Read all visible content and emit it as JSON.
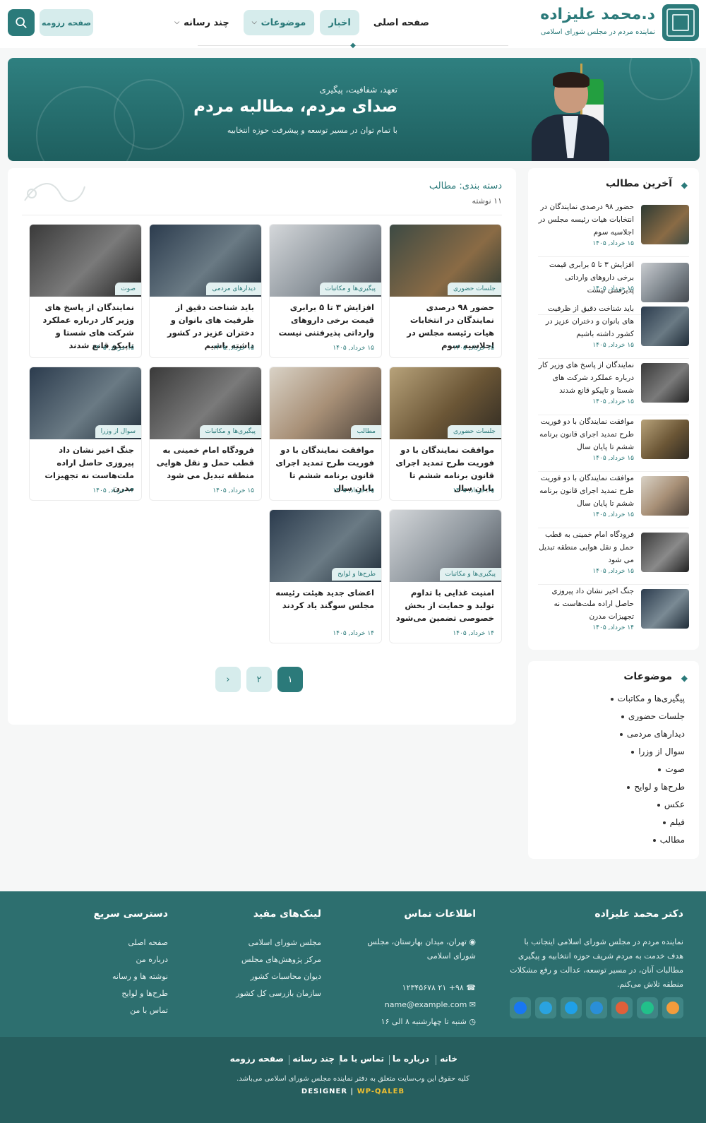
{
  "header": {
    "title": "د.محمد علیزاده",
    "subtitle": "نماینده مردم در مجلس شورای اسلامی",
    "nav": [
      {
        "label": "صفحه اصلی",
        "active": false,
        "dropdown": false
      },
      {
        "label": "اخبار",
        "active": true,
        "dropdown": false
      },
      {
        "label": "موضوعات",
        "active": true,
        "dropdown": true
      },
      {
        "label": "چند رسانه",
        "active": false,
        "dropdown": true
      }
    ],
    "resume_label": "صفحه رزومه",
    "search_icon": "search-icon"
  },
  "hero": {
    "kicker": "تعهد، شفافیت، پیگیری",
    "title": "صدای مردم، مطالبه مردم",
    "subtitle": "با تمام توان در مسیر توسعه و پیشرفت حوزه انتخابیه"
  },
  "main": {
    "category_title": "دسته بندی: مطالب",
    "count": "۱۱ نوشته",
    "cards": [
      {
        "tag": "جلسات حضوری",
        "title": "حضور ۹۸ درصدی نمایندگان در انتخابات هیات رئیسه مجلس در اجلاسیه سوم",
        "date": "۱۵ خرداد, ۱۴۰۵"
      },
      {
        "tag": "پیگیری‌ها و مکاتبات",
        "title": "افزایش ۳ تا ۵ برابری قیمت برخی داروهای وارداتی پذیرفتنی نیست",
        "date": "۱۵ خرداد, ۱۴۰۵"
      },
      {
        "tag": "دیدارهای مردمی",
        "title": "باید شناخت دقیق از ظرفیت های بانوان و دختران عزیز در کشور داشته باشیم",
        "date": "۱۵ خرداد, ۱۴۰۵"
      },
      {
        "tag": "صوت",
        "title": "نمایندگان از پاسخ های وزیر کار درباره عملکرد شرکت های شستا و تاپیکو قانع شدند",
        "date": "۱۵ خرداد, ۱۴۰۵"
      },
      {
        "tag": "جلسات حضوری",
        "title": "موافقت نمایندگان با دو فوریت طرح تمدید اجرای قانون برنامه ششم تا پایان سال",
        "date": "۱۵ خرداد, ۱۴۰۵"
      },
      {
        "tag": "مطالب",
        "title": "موافقت نمایندگان با دو فوریت طرح تمدید اجرای قانون برنامه ششم تا پایان سال",
        "date": "۱۵ خرداد, ۱۴۰۵"
      },
      {
        "tag": "پیگیری‌ها و مکاتبات",
        "title": "فرودگاه امام خمینی به قطب حمل و نقل هوایی منطقه تبدیل می شود",
        "date": "۱۵ خرداد, ۱۴۰۵"
      },
      {
        "tag": "سوال از وزرا",
        "title": "جنگ اخیر نشان داد پیروزی حاصل اراده ملت‌هاست نه تجهیزات مدرن",
        "date": "۱۴ خرداد, ۱۴۰۵"
      },
      {
        "tag": "پیگیری‌ها و مکاتبات",
        "title": "امنیت غذایی با تداوم تولید و حمایت از بخش خصوصی تضمین می‌شود",
        "date": "۱۴ خرداد, ۱۴۰۵"
      },
      {
        "tag": "طرح‌ها و لوایح",
        "title": "اعضای جدید هیئت رئیسه مجلس سوگند یاد کردند",
        "date": "۱۴ خرداد, ۱۴۰۵"
      }
    ],
    "pagination": [
      "۱",
      "۲",
      "›"
    ]
  },
  "sidebar": {
    "recent_title": "آخرین مطالب",
    "recent": [
      {
        "title": "حضور ۹۸ درصدی نمایندگان در انتخابات هیات رئیسه مجلس در اجلاسیه سوم",
        "date": "۱۵ خرداد, ۱۴۰۵"
      },
      {
        "title": "افزایش ۳ تا ۵ برابری قیمت برخی داروهای وارداتی پذیرفتنی نیست",
        "date": "۱۵ خرداد, ۱۴۰۵"
      },
      {
        "title": "باید شناخت دقیق از ظرفیت های بانوان و دختران عزیز در کشور داشته باشیم",
        "date": "۱۵ خرداد, ۱۴۰۵"
      },
      {
        "title": "نمایندگان از پاسخ های وزیر کار درباره عملکرد شرکت های شستا و تاپیکو قانع شدند",
        "date": "۱۵ خرداد, ۱۴۰۵"
      },
      {
        "title": "موافقت نمایندگان با دو فوریت طرح تمدید اجرای قانون برنامه ششم تا پایان سال",
        "date": "۱۵ خرداد, ۱۴۰۵"
      },
      {
        "title": "موافقت نمایندگان با دو فوریت طرح تمدید اجرای قانون برنامه ششم تا پایان سال",
        "date": "۱۵ خرداد, ۱۴۰۵"
      },
      {
        "title": "فرودگاه امام خمینی به قطب حمل و نقل هوایی منطقه تبدیل می شود",
        "date": "۱۵ خرداد, ۱۴۰۵"
      },
      {
        "title": "جنگ اخیر نشان داد پیروزی حاصل اراده ملت‌هاست نه تجهیزات مدرن",
        "date": "۱۴ خرداد, ۱۴۰۵"
      }
    ],
    "topics_title": "موضوعات",
    "topics": [
      "پیگیری‌ها و مکاتبات",
      "جلسات حضوری",
      "دیدارهای مردمی",
      "سوال از وزرا",
      "صوت",
      "طرح‌ها و لوایح",
      "عکس",
      "فیلم",
      "مطالب"
    ]
  },
  "footer": {
    "about_title": "دکتر محمد علیزاده",
    "about_text": "نماینده مردم در مجلس شورای اسلامی اینجانب با هدف خدمت به مردم شریف حوزه انتخابیه و پیگیری مطالبات آنان، در مسیر توسعه، عدالت و رفع مشکلات منطقه تلاش می‌کنم.",
    "contact_title": "اطلاعات تماس",
    "contact": {
      "address": "تهران، میدان بهارستان، مجلس شورای اسلامی",
      "phone": "۹۸+ ۲۱ ۱۲۳۴۵۶۷۸",
      "email": "name@example.com",
      "hours": "شنبه تا چهارشنبه ۸ الی ۱۶"
    },
    "useful_title": "لینک‌های مفید",
    "useful": [
      "مجلس شورای اسلامی",
      "مرکز پژوهش‌های مجلس",
      "دیوان محاسبات کشور",
      "سازمان بازرسی کل کشور"
    ],
    "quick_title": "دسترسی سریع",
    "quick": [
      "صفحه اصلی",
      "درباره من",
      "نوشته ها و رسانه",
      "طرح‌ها و لوایح",
      "تماس با من"
    ],
    "social": [
      {
        "icon": "eitaa-icon",
        "color": "#f39c3c"
      },
      {
        "icon": "bale-icon",
        "color": "#22c08a"
      },
      {
        "icon": "rubika-icon",
        "color": "#e0603a"
      },
      {
        "icon": "soroush-icon",
        "color": "#2a8fd8"
      },
      {
        "icon": "igap-icon",
        "color": "#1fa0e8"
      },
      {
        "icon": "telegram-icon",
        "color": "#2aa3e0"
      },
      {
        "icon": "facebook-icon",
        "color": "#1877f2"
      }
    ],
    "bottom_links": [
      "خانه",
      "درباره ما",
      "تماس با ما",
      "چند رسانه",
      "صفحه رزومه"
    ],
    "copyright": "کلیه حقوق این وب‌سایت متعلق به دفتر نماینده مجلس شورای اسلامی می‌باشد.",
    "designer_label": "DESIGNER",
    "designer_name": "WP-QALEB"
  }
}
